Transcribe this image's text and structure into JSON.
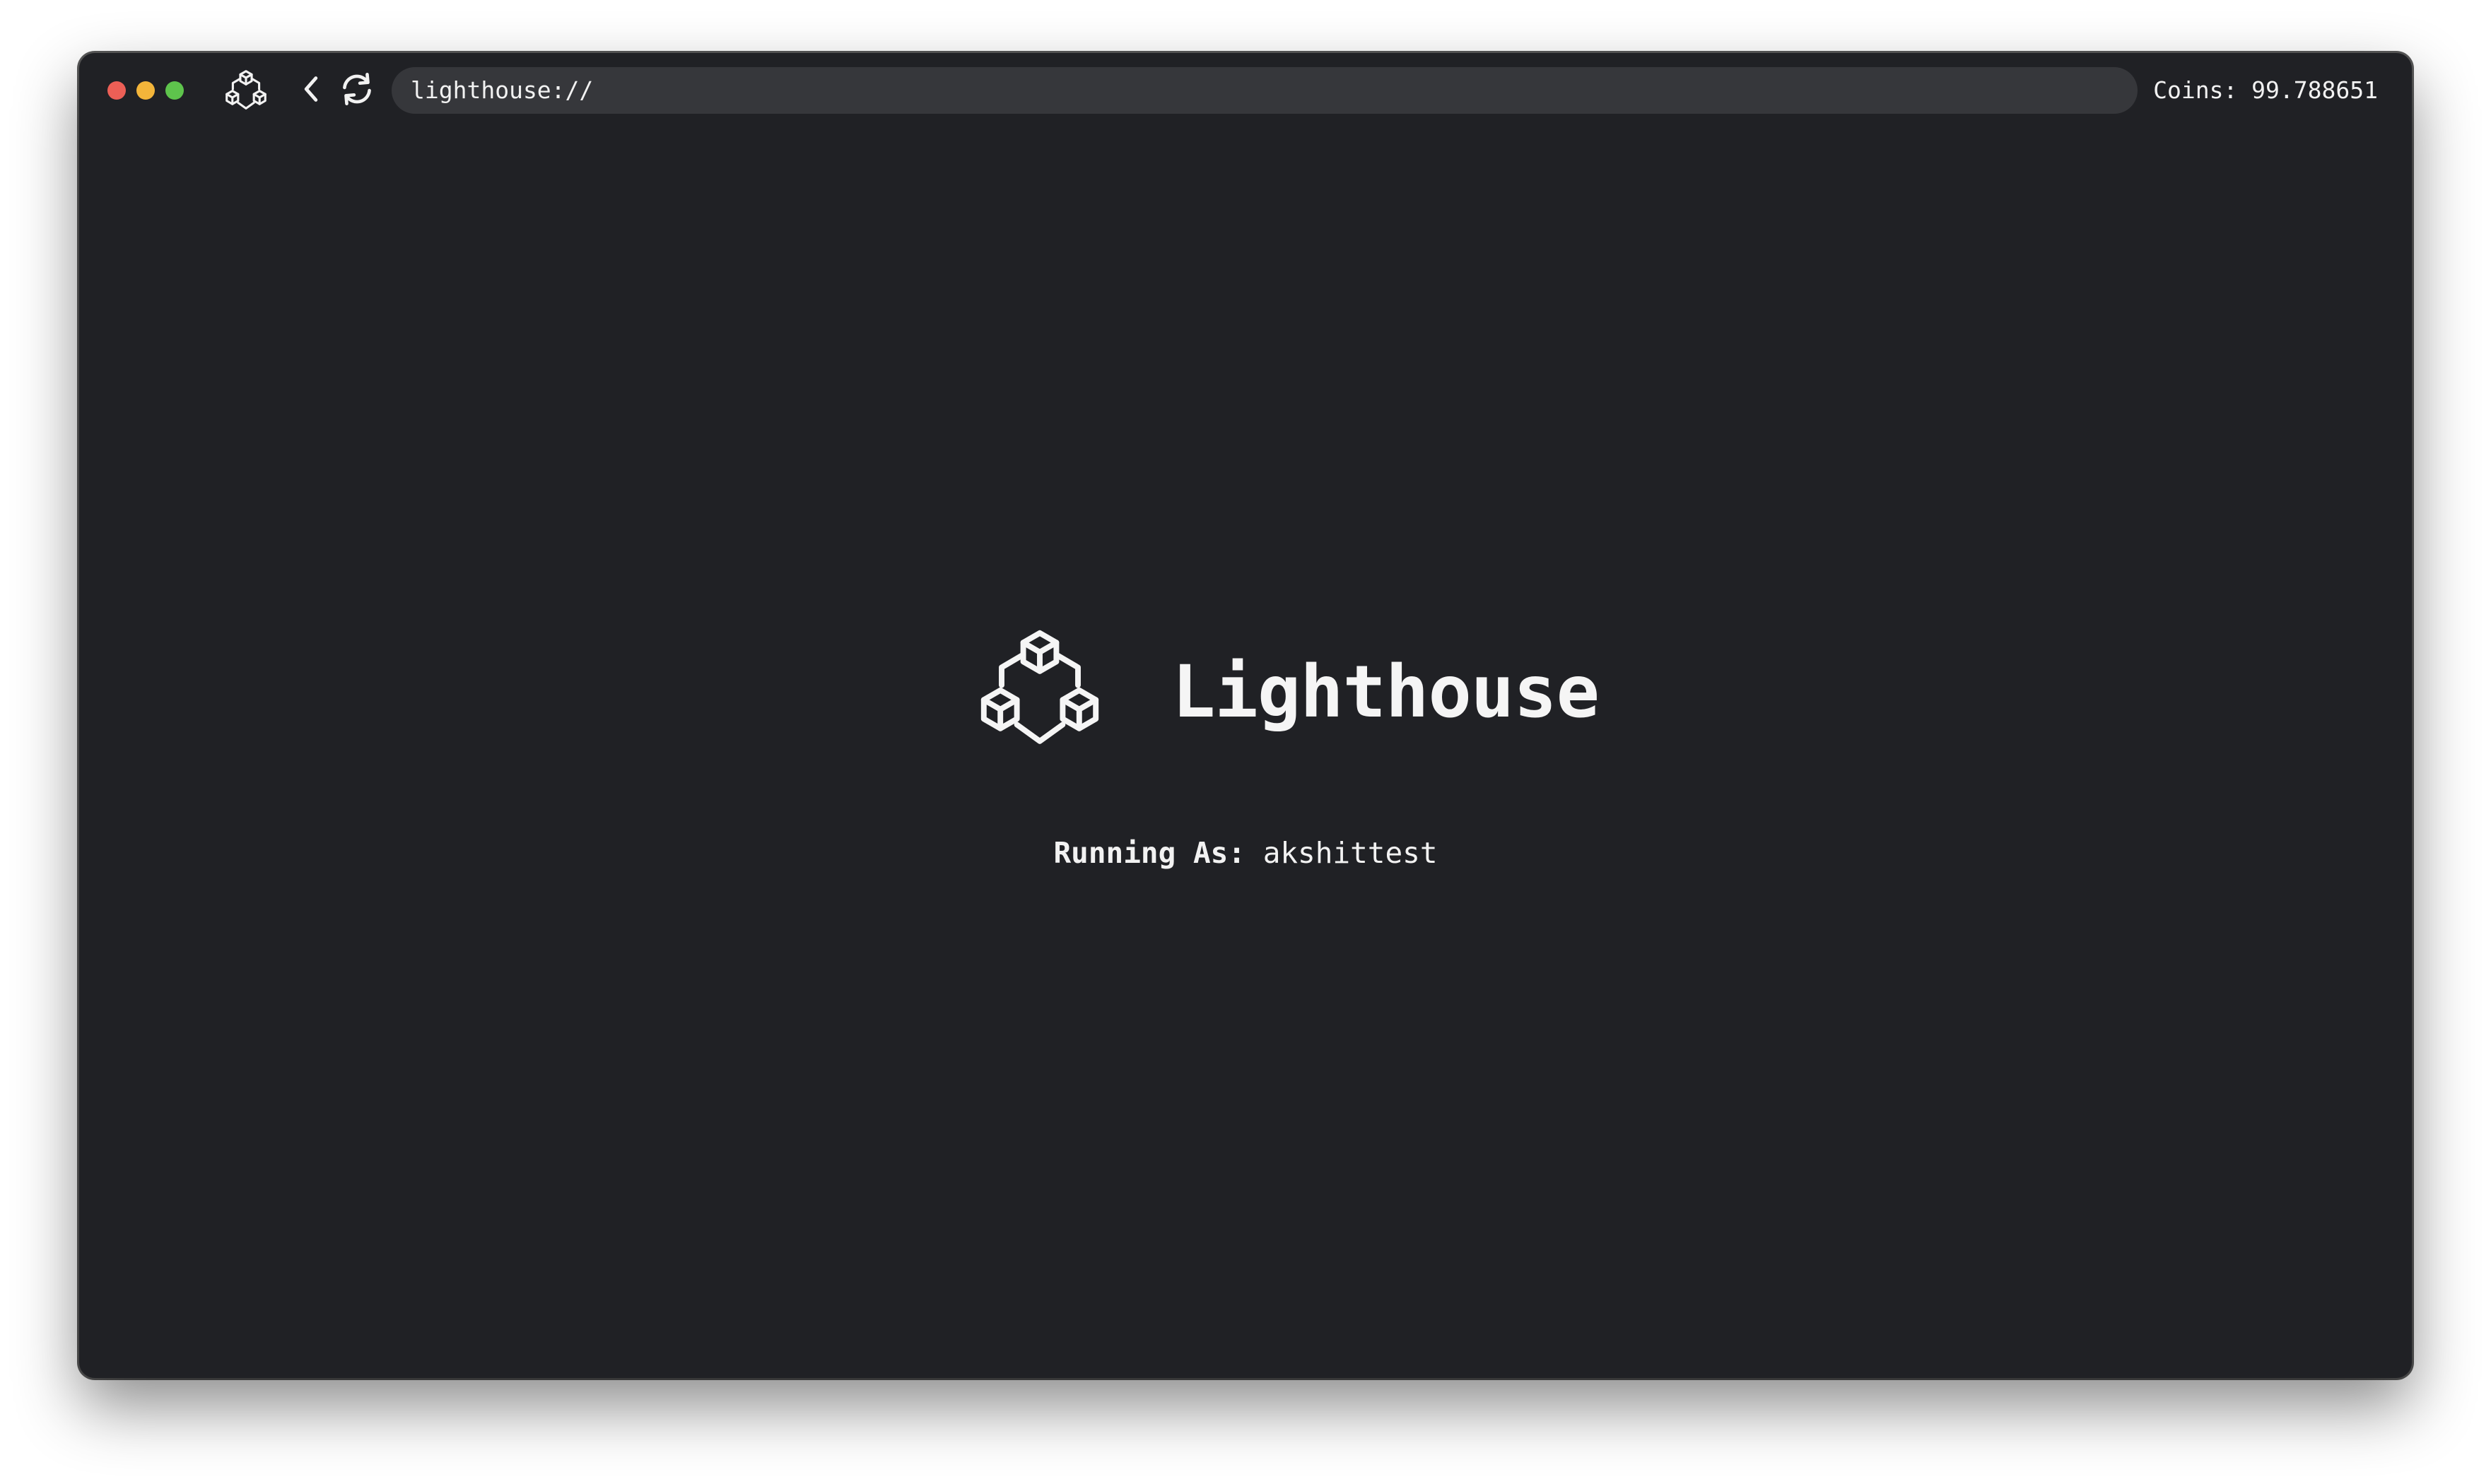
{
  "window": {
    "traffic_lights": [
      "close",
      "minimize",
      "maximize"
    ]
  },
  "toolbar": {
    "logo_icon": "cubes-logo-icon",
    "back_icon": "chevron-left-icon",
    "reload_icon": "refresh-icon",
    "url": "lighthouse://",
    "coins": "Coins: 99.788651"
  },
  "main": {
    "app_name": "Lighthouse",
    "logo_icon": "cubes-logo-icon",
    "running_as_label": "Running As:",
    "username": "akshittest"
  },
  "colors": {
    "background": "#202125",
    "url_bar": "#36373b",
    "text": "#f2f2f2",
    "close": "#ec5f56",
    "minimize": "#f3b53a",
    "maximize": "#5ec44c"
  }
}
